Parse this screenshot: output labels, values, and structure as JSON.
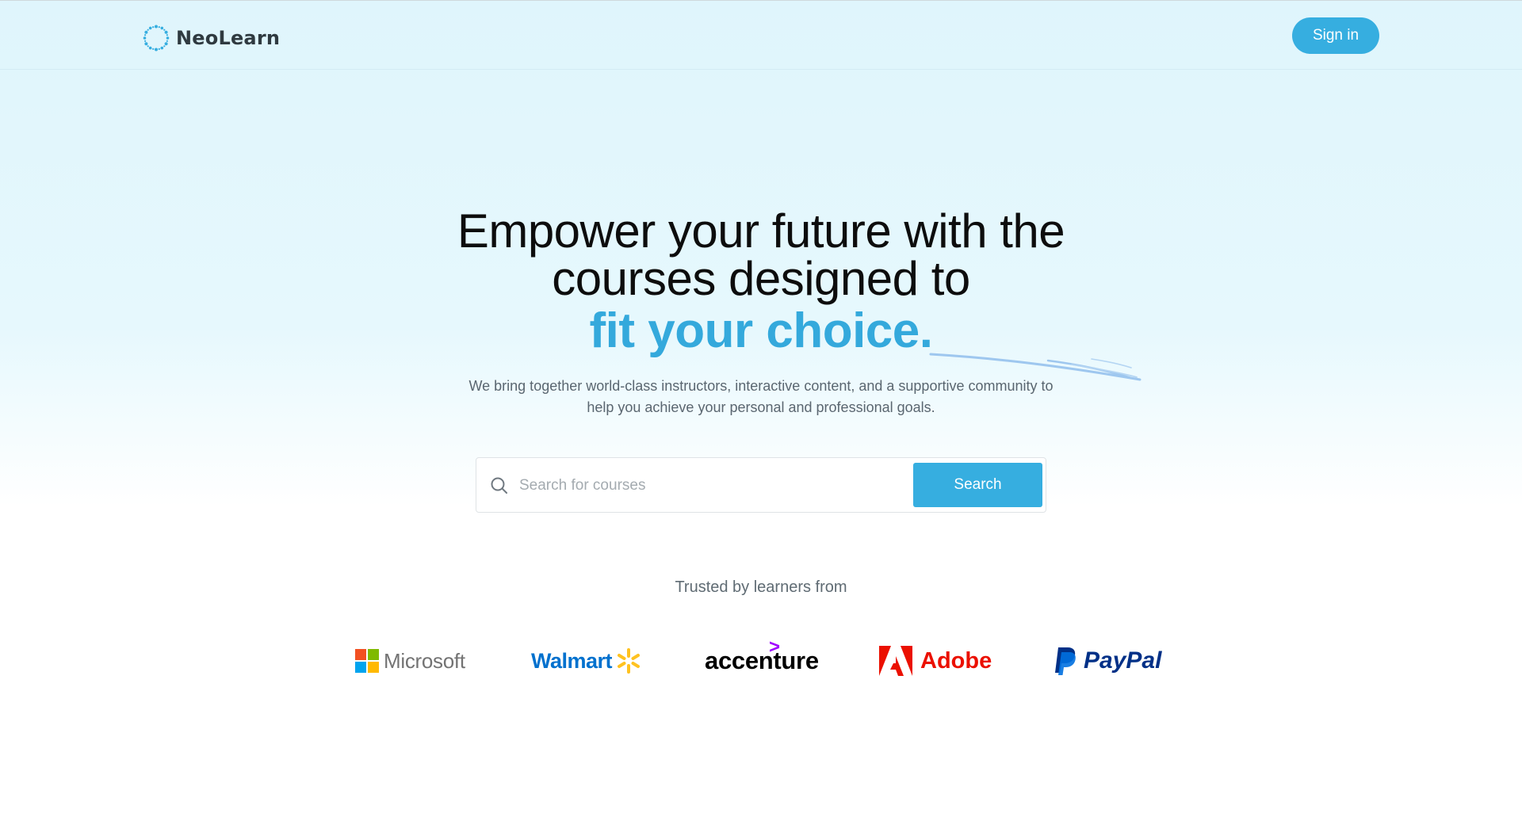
{
  "header": {
    "logo_text": "NeoLearn",
    "signin_label": "Sign in"
  },
  "hero": {
    "headline_line1": "Empower your future with the",
    "headline_line2": "courses designed to",
    "headline_accent": "fit your choice.",
    "subtitle_line1": "We bring together world-class instructors, interactive content, and a supportive community to",
    "subtitle_line2": "help you achieve your personal and professional goals."
  },
  "search": {
    "placeholder": "Search for courses",
    "value": "",
    "button_label": "Search"
  },
  "trusted": {
    "label": "Trusted by learners from",
    "brands": [
      {
        "name": "Microsoft",
        "icon": "microsoft-logo-icon"
      },
      {
        "name": "Walmart",
        "icon": "walmart-spark-icon"
      },
      {
        "name": "accenture",
        "icon": "accenture-caret-icon"
      },
      {
        "name": "Adobe",
        "icon": "adobe-logo-icon"
      },
      {
        "name": "PayPal",
        "icon": "paypal-logo-icon"
      }
    ]
  },
  "colors": {
    "accent": "#36aee0",
    "headline_accent": "#34a9dc",
    "background_top": "#dff5fc",
    "text_dark": "#0d0d0d",
    "text_muted": "#5a6670"
  }
}
